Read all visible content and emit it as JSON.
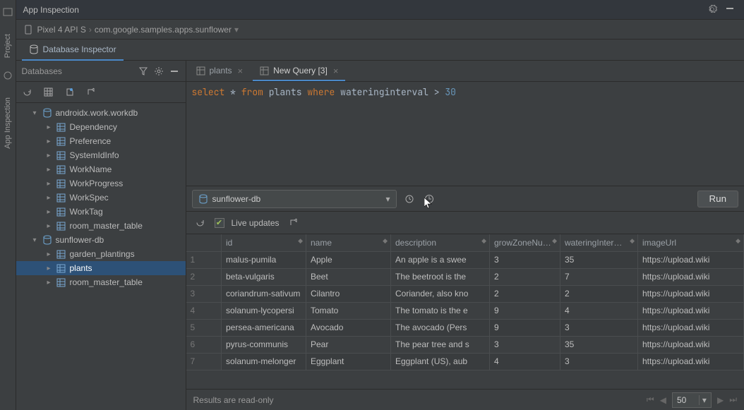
{
  "window": {
    "title": "App Inspection"
  },
  "rail": {
    "primary": "Project",
    "secondary": "App Inspection"
  },
  "breadcrumb": {
    "device": "Pixel 4 API S",
    "app": "com.google.samples.apps.sunflower"
  },
  "inspector_tab": "Database Inspector",
  "sidebar": {
    "header": "Databases",
    "databases": [
      {
        "name": "androidx.work.workdb",
        "expanded": true,
        "tables": [
          "Dependency",
          "Preference",
          "SystemIdInfo",
          "WorkName",
          "WorkProgress",
          "WorkSpec",
          "WorkTag",
          "room_master_table"
        ]
      },
      {
        "name": "sunflower-db",
        "expanded": true,
        "tables": [
          "garden_plantings",
          "plants",
          "room_master_table"
        ],
        "selected_table": "plants"
      }
    ]
  },
  "editor": {
    "tabs": [
      {
        "label": "plants",
        "active": false
      },
      {
        "label": "New Query  [3]",
        "active": true
      }
    ],
    "query_plain": "select * from plants where wateringinterval > 30",
    "query_tokens": [
      {
        "t": "select",
        "c": "kw-select"
      },
      {
        "t": " * ",
        "c": "kw-ident"
      },
      {
        "t": "from",
        "c": "kw-func"
      },
      {
        "t": " plants ",
        "c": "kw-ident"
      },
      {
        "t": "where",
        "c": "kw-where"
      },
      {
        "t": " wateringinterval > ",
        "c": "kw-ident"
      },
      {
        "t": "30",
        "c": "kw-num"
      }
    ],
    "db_selector": "sunflower-db",
    "run_label": "Run",
    "live_updates_label": "Live updates",
    "live_updates_checked": true
  },
  "table": {
    "columns": [
      "id",
      "name",
      "description",
      "growZoneNu…",
      "wateringInter…",
      "imageUrl"
    ],
    "rows": [
      [
        "malus-pumila",
        "Apple",
        "An apple is a swee",
        "3",
        "35",
        "https://upload.wiki"
      ],
      [
        "beta-vulgaris",
        "Beet",
        "The beetroot is the",
        "2",
        "7",
        "https://upload.wiki"
      ],
      [
        "coriandrum-sativum",
        "Cilantro",
        "Coriander, also kno",
        "2",
        "2",
        "https://upload.wiki"
      ],
      [
        "solanum-lycopersi",
        "Tomato",
        "The tomato is the e",
        "9",
        "4",
        "https://upload.wiki"
      ],
      [
        "persea-americana",
        "Avocado",
        "The avocado (Pers",
        "9",
        "3",
        "https://upload.wiki"
      ],
      [
        "pyrus-communis",
        "Pear",
        "The pear tree and s",
        "3",
        "35",
        "https://upload.wiki"
      ],
      [
        "solanum-melonger",
        "Eggplant",
        "Eggplant (US), aub",
        "4",
        "3",
        "https://upload.wiki"
      ]
    ]
  },
  "footer": {
    "status": "Results are read-only",
    "page_size": "50"
  }
}
